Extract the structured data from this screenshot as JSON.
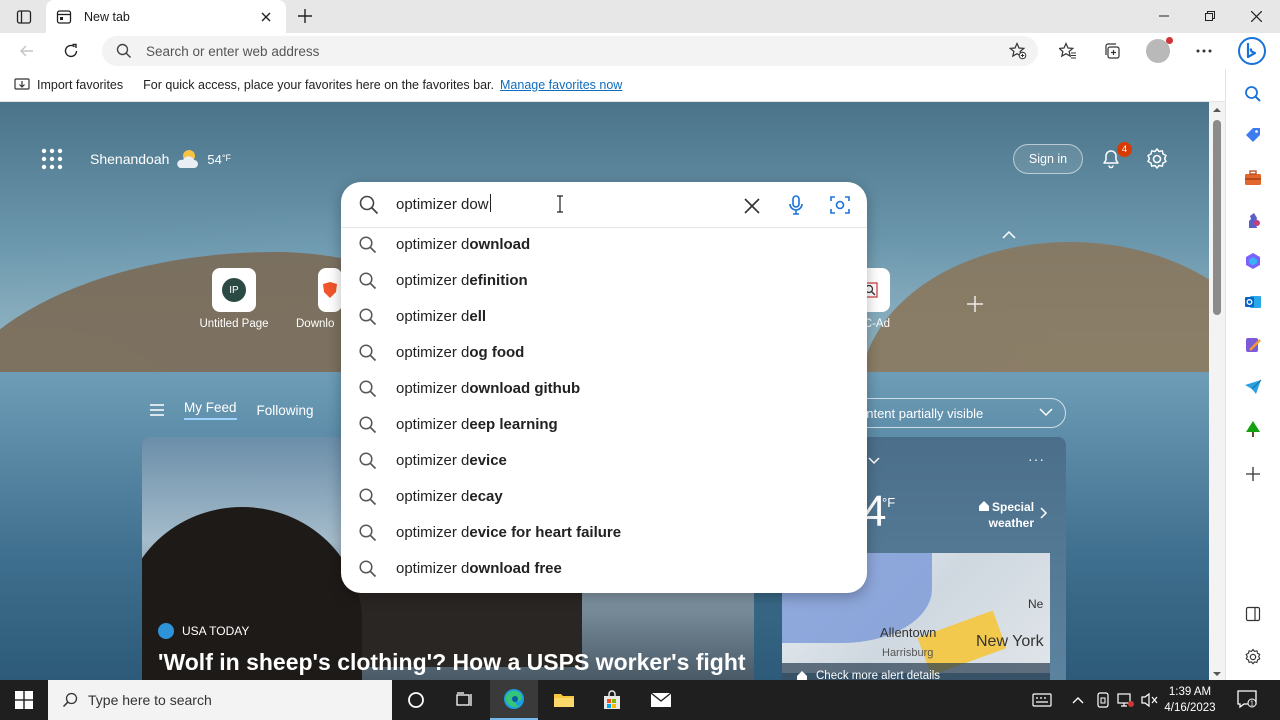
{
  "browser": {
    "tab_title": "New tab",
    "address_placeholder": "Search or enter web address",
    "favbar": {
      "import_label": "Import favorites",
      "hint": "For quick access, place your favorites here on the favorites bar.",
      "manage_link": "Manage favorites now"
    }
  },
  "newtab": {
    "location": "Shenandoah",
    "temperature": "54",
    "temp_unit": "°F",
    "signin_label": "Sign in",
    "notification_count": "4",
    "quicklinks": [
      {
        "initials": "IP",
        "label": "Untitled Page"
      },
      {
        "label": "Downlo"
      },
      {
        "label": "C-Ad"
      }
    ],
    "feed_tabs": [
      "My Feed",
      "Following"
    ],
    "visibility_label": "ontent partially visible",
    "news_card": {
      "source": "USA TODAY",
      "headline": "'Wolf in sheep's clothing'? How a USPS worker's fight"
    },
    "weather_card": {
      "temp": "4",
      "unit": "°F",
      "alert_line1": "Special",
      "alert_line2": "weather",
      "cities": [
        "Allentown",
        "New York",
        "Harrisburg"
      ],
      "map_edge_label": "Ne",
      "alert_details": "Check more alert details"
    }
  },
  "search": {
    "query": "optimizer dow",
    "suggestions": [
      {
        "prefix": "optimizer d",
        "bold": "ownload"
      },
      {
        "prefix": "optimizer d",
        "bold": "efinition"
      },
      {
        "prefix": "optimizer d",
        "bold": "ell"
      },
      {
        "prefix": "optimizer d",
        "bold": "og food"
      },
      {
        "prefix": "optimizer d",
        "bold": "ownload github"
      },
      {
        "prefix": "optimizer d",
        "bold": "eep learning"
      },
      {
        "prefix": "optimizer d",
        "bold": "evice"
      },
      {
        "prefix": "optimizer d",
        "bold": "ecay"
      },
      {
        "prefix": "optimizer d",
        "bold": "evice for heart failure"
      },
      {
        "prefix": "optimizer d",
        "bold": "ownload free"
      }
    ]
  },
  "taskbar": {
    "search_placeholder": "Type here to search",
    "time": "1:39 AM",
    "date": "4/16/2023"
  },
  "colors": {
    "accent": "#0f6cbd",
    "badge": "#d83b01",
    "taskbar": "#1f1f1f"
  }
}
